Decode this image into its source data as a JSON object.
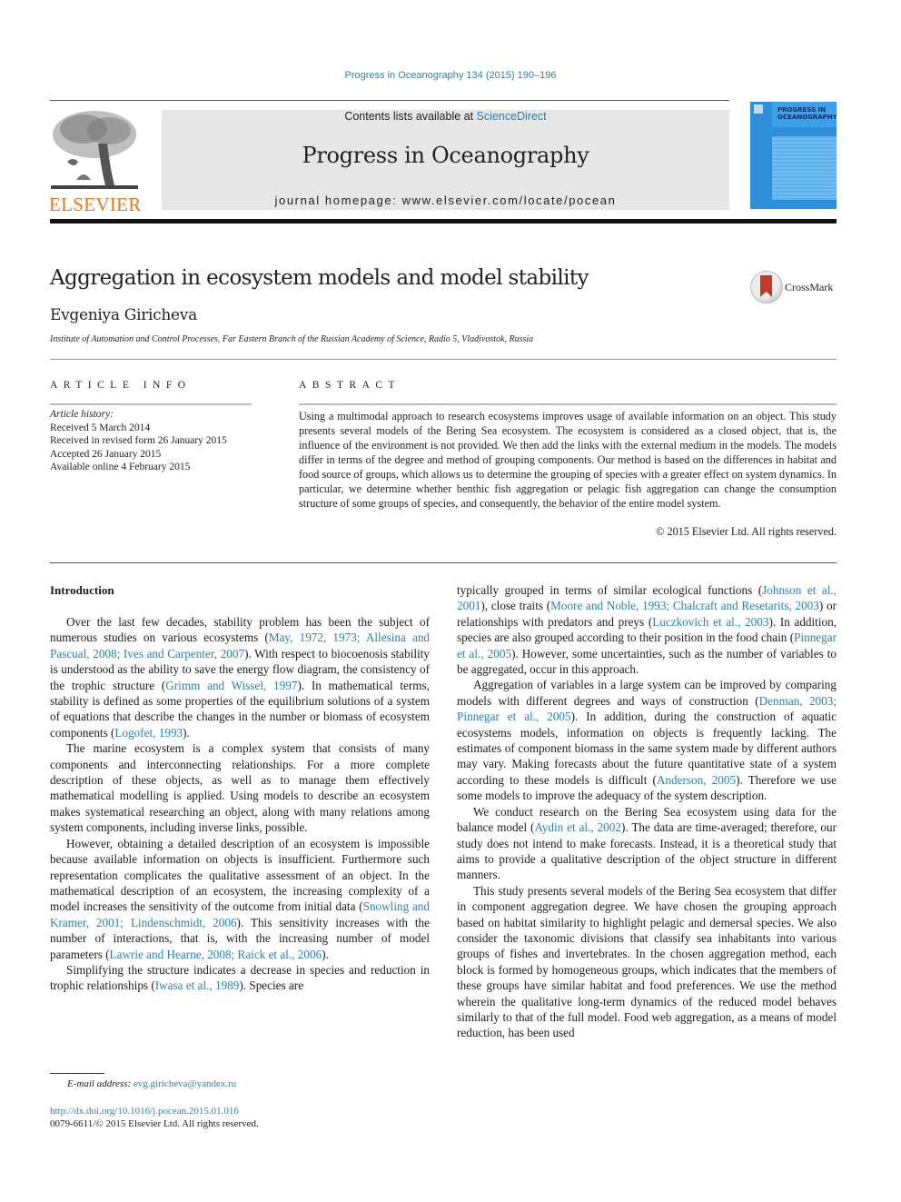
{
  "header": {
    "journal_ref": "Progress in Oceanography 134 (2015) 190–196",
    "contents_prefix": "Contents lists available at ",
    "contents_link": "ScienceDirect",
    "journal_name": "Progress in Oceanography",
    "homepage": "journal homepage: www.elsevier.com/locate/pocean",
    "publisher_logo_text": "ELSEVIER",
    "cover_title_line1": "PROGRESS IN",
    "cover_title_line2": "OCEANOGRAPHY",
    "brand_color": "#e8741b",
    "link_color": "#2a7fb0"
  },
  "article": {
    "title": "Aggregation in ecosystem models and model stability",
    "crossmark_label": "CrossMark",
    "author": "Evgeniya Giricheva",
    "affiliation": "Institute of Automation and Control Processes, Far Eastern Branch of the Russian Academy of Science, Radio 5, Vladivostok, Russia"
  },
  "article_info": {
    "label": "ARTICLE INFO",
    "history_title": "Article history:",
    "history": [
      "Received 5 March 2014",
      "Received in revised form 26 January 2015",
      "Accepted 26 January 2015",
      "Available online 4 February 2015"
    ]
  },
  "abstract": {
    "label": "ABSTRACT",
    "text": "Using a multimodal approach to research ecosystems improves usage of available information on an object. This study presents several models of the Bering Sea ecosystem. The ecosystem is considered as a closed object, that is, the influence of the environment is not provided. We then add the links with the external medium in the models. The models differ in terms of the degree and method of grouping components. Our method is based on the differences in habitat and food source of groups, which allows us to determine the grouping of species with a greater effect on system dynamics. In particular, we determine whether benthic fish aggregation or pelagic fish aggregation can change the consumption structure of some groups of species, and consequently, the behavior of the entire model system.",
    "copyright": "© 2015 Elsevier Ltd. All rights reserved."
  },
  "body": {
    "intro_heading": "Introduction",
    "p1": {
      "t1": "Over the last few decades, stability problem has been the subject of numerous studies on various ecosystems (",
      "c1": "May, 1972, 1973; Allesina and Pascual, 2008; Ives and Carpenter, 2007",
      "t2": "). With respect to biocoenosis stability is understood as the ability to save the energy flow diagram, the consistency of the trophic structure (",
      "c2": "Grimm and Wissel, 1997",
      "t3": "). In mathematical terms, stability is defined as some properties of the equilibrium solutions of a system of equations that describe the changes in the number or biomass of ecosystem components (",
      "c3": "Logofet, 1993",
      "t4": ")."
    },
    "p2": "The marine ecosystem is a complex system that consists of many components and interconnecting relationships. For a more complete description of these objects, as well as to manage them effectively mathematical modelling is applied. Using models to describe an ecosystem makes systematical researching an object, along with many relations among system components, including inverse links, possible.",
    "p3": {
      "t1": "However, obtaining a detailed description of an ecosystem is impossible because available information on objects is insufficient. Furthermore such representation complicates the qualitative assessment of an object. In the mathematical description of an ecosystem, the increasing complexity of a model increases the sensitivity of the outcome from initial data (",
      "c1": "Snowling and Kramer, 2001; Lindenschmidt, 2006",
      "t2": "). This sensitivity increases with the number of interactions, that is, with the increasing number of model parameters (",
      "c2": "Lawrie and Hearne, 2008; Raick et al., 2006",
      "t3": ")."
    },
    "p4": {
      "t1": "Simplifying the structure indicates a decrease in species and reduction in trophic relationships (",
      "c1": "Iwasa et al., 1989",
      "t2": "). Species are"
    },
    "p5": {
      "t1": "typically grouped in terms of similar ecological functions (",
      "c1": "Johnson et al., 2001",
      "t2": "), close traits (",
      "c2": "Moore and Noble, 1993; Chalcraft and Resetarits, 2003",
      "t3": ") or relationships with predators and preys (",
      "c3": "Luczkovich et al., 2003",
      "t4": "). In addition, species are also grouped according to their position in the food chain (",
      "c4": "Pinnegar et al., 2005",
      "t5": "). However, some uncertainties, such as the number of variables to be aggregated, occur in this approach."
    },
    "p6": {
      "t1": "Aggregation of variables in a large system can be improved by comparing models with different degrees and ways of construction (",
      "c1": "Denman, 2003; Pinnegar et al., 2005",
      "t2": "). In addition, during the construction of aquatic ecosystems models, information on objects is frequently lacking. The estimates of component biomass in the same system made by different authors may vary. Making forecasts about the future quantitative state of a system according to these models is difficult (",
      "c2": "Anderson, 2005",
      "t3": "). Therefore we use some models to improve the adequacy of the system description."
    },
    "p7": {
      "t1": "We conduct research on the Bering Sea ecosystem using data for the balance model (",
      "c1": "Aydin et al., 2002",
      "t2": "). The data are time-averaged; therefore, our study does not intend to make forecasts. Instead, it is a theoretical study that aims to provide a qualitative description of the object structure in different manners."
    },
    "p8": "This study presents several models of the Bering Sea ecosystem that differ in component aggregation degree. We have chosen the grouping approach based on habitat similarity to highlight pelagic and demersal species. We also consider the taxonomic divisions that classify sea inhabitants into various groups of fishes and invertebrates. In the chosen aggregation method, each block is formed by homogeneous groups, which indicates that the members of these groups have similar habitat and food preferences. We use the method wherein the qualitative long-term dynamics of the reduced model behaves similarly to that of the full model. Food web aggregation, as a means of model reduction, has been used"
  },
  "footer": {
    "email_label": "E-mail address: ",
    "email": "evg.giricheva@yandex.ru",
    "doi": "http://dx.doi.org/10.1016/j.pocean.2015.01.016",
    "issn": "0079-6611/© 2015 Elsevier Ltd. All rights reserved."
  }
}
